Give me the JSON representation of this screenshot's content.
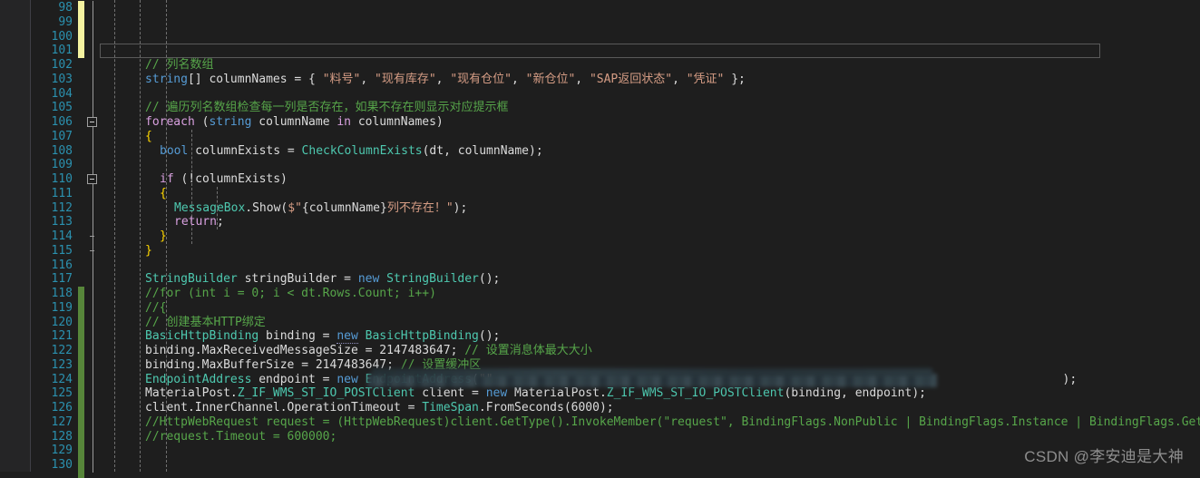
{
  "editor": {
    "theme": "visual-studio-dark",
    "background": "#1e1e1e",
    "gutter_background": "#252526",
    "line_number_color": "#2b91af",
    "comment_color": "#57a64a",
    "keyword_color": "#569cd6",
    "type_color": "#4ec9b0",
    "string_color": "#d69d85",
    "change_bar_unsaved_color": "#f5f3a0",
    "change_bar_saved_color": "#57863a",
    "first_line_number": 98,
    "last_line_number": 130
  },
  "line_numbers": [
    98,
    99,
    100,
    101,
    102,
    103,
    104,
    105,
    106,
    107,
    108,
    109,
    110,
    111,
    112,
    113,
    114,
    115,
    116,
    117,
    118,
    119,
    120,
    121,
    122,
    123,
    124,
    125,
    126,
    127,
    128,
    129,
    130
  ],
  "code_lines": [
    {
      "n": 98,
      "text": ""
    },
    {
      "n": 99,
      "text": ""
    },
    {
      "n": 100,
      "text": ""
    },
    {
      "n": 101,
      "text": ""
    },
    {
      "n": 102,
      "text": "            // 列名数组"
    },
    {
      "n": 103,
      "text": "            string[] columnNames = { \"料号\", \"现有库存\", \"现有仓位\", \"新仓位\", \"SAP返回状态\", \"凭证\" };"
    },
    {
      "n": 104,
      "text": ""
    },
    {
      "n": 105,
      "text": "            // 遍历列名数组检查每一列是否存在，如果不存在则显示对应提示框"
    },
    {
      "n": 106,
      "text": "            foreach (string columnName in columnNames)"
    },
    {
      "n": 107,
      "text": "            {"
    },
    {
      "n": 108,
      "text": "                bool columnExists = CheckColumnExists(dt, columnName);"
    },
    {
      "n": 109,
      "text": ""
    },
    {
      "n": 110,
      "text": "                if (!columnExists)"
    },
    {
      "n": 111,
      "text": "                {"
    },
    {
      "n": 112,
      "text": "                    MessageBox.Show($\"{columnName}列不存在！\");"
    },
    {
      "n": 113,
      "text": "                    return;"
    },
    {
      "n": 114,
      "text": "                }"
    },
    {
      "n": 115,
      "text": "            }"
    },
    {
      "n": 116,
      "text": ""
    },
    {
      "n": 117,
      "text": "            StringBuilder stringBuilder = new StringBuilder();"
    },
    {
      "n": 118,
      "text": "            //for (int i = 0; i < dt.Rows.Count; i++)"
    },
    {
      "n": 119,
      "text": "            //{"
    },
    {
      "n": 120,
      "text": "            // 创建基本HTTP绑定"
    },
    {
      "n": 121,
      "text": "            BasicHttpBinding binding = new BasicHttpBinding();"
    },
    {
      "n": 122,
      "text": "            binding.MaxReceivedMessageSize = 2147483647; // 设置消息体最大大小"
    },
    {
      "n": 123,
      "text": "            binding.MaxBufferSize = 2147483647; // 设置缓冲区"
    },
    {
      "n": 124,
      "text": "            EndpointAddress endpoint = new EndpointAddress(\"\");"
    },
    {
      "n": 125,
      "text": "            MaterialPost.Z_IF_WMS_ST_IO_POSTClient client = new MaterialPost.Z_IF_WMS_ST_IO_POSTClient(binding, endpoint);"
    },
    {
      "n": 126,
      "text": "            client.InnerChannel.OperationTimeout = TimeSpan.FromSeconds(6000);"
    },
    {
      "n": 127,
      "text": "            //HttpWebRequest request = (HttpWebRequest)client.GetType().InvokeMember(\"request\", BindingFlags.NonPublic | BindingFlags.Instance | BindingFlags.GetField, null, client, null);"
    },
    {
      "n": 128,
      "text": "            //request.Timeout = 600000;"
    },
    {
      "n": 129,
      "text": ""
    },
    {
      "n": 130,
      "text": ""
    }
  ],
  "tokens": {
    "l102": [
      {
        "t": "// 列名数组",
        "c": "cmt"
      }
    ],
    "l103": [
      {
        "t": "string",
        "c": "kw"
      },
      {
        "t": "[] ",
        "c": "pun"
      },
      {
        "t": "columnNames",
        "c": "id"
      },
      {
        "t": " = { ",
        "c": "pun"
      },
      {
        "t": "\"料号\"",
        "c": "str"
      },
      {
        "t": ", ",
        "c": "pun"
      },
      {
        "t": "\"现有库存\"",
        "c": "str"
      },
      {
        "t": ", ",
        "c": "pun"
      },
      {
        "t": "\"现有仓位\"",
        "c": "str"
      },
      {
        "t": ", ",
        "c": "pun"
      },
      {
        "t": "\"新仓位\"",
        "c": "str"
      },
      {
        "t": ", ",
        "c": "pun"
      },
      {
        "t": "\"SAP返回状态\"",
        "c": "str"
      },
      {
        "t": ", ",
        "c": "pun"
      },
      {
        "t": "\"凭证\"",
        "c": "str"
      },
      {
        "t": " };",
        "c": "pun"
      }
    ],
    "l105": [
      {
        "t": "// 遍历列名数组检查每一列是否存在，如果不存在则显示对应提示框",
        "c": "cmt"
      }
    ],
    "l106": [
      {
        "t": "foreach",
        "c": "kwc"
      },
      {
        "t": " (",
        "c": "pun"
      },
      {
        "t": "string",
        "c": "kw"
      },
      {
        "t": " columnName ",
        "c": "id"
      },
      {
        "t": "in",
        "c": "kwc"
      },
      {
        "t": " columnNames)",
        "c": "id"
      }
    ],
    "l108": [
      {
        "t": "bool",
        "c": "kw"
      },
      {
        "t": " columnExists = ",
        "c": "id"
      },
      {
        "t": "CheckColumnExists",
        "c": "typ"
      },
      {
        "t": "(dt, columnName);",
        "c": "id"
      }
    ],
    "l110": [
      {
        "t": "if",
        "c": "kwc"
      },
      {
        "t": " (!columnExists)",
        "c": "id"
      }
    ],
    "l112": [
      {
        "t": "MessageBox",
        "c": "typ"
      },
      {
        "t": ".",
        "c": "pun"
      },
      {
        "t": "Show",
        "c": "id"
      },
      {
        "t": "(",
        "c": "pun"
      },
      {
        "t": "$\"",
        "c": "str"
      },
      {
        "t": "{",
        "c": "pun"
      },
      {
        "t": "columnName",
        "c": "id"
      },
      {
        "t": "}",
        "c": "pun"
      },
      {
        "t": "列不存在！\"",
        "c": "str"
      },
      {
        "t": ");",
        "c": "pun"
      }
    ],
    "l113": [
      {
        "t": "return",
        "c": "kwc"
      },
      {
        "t": ";",
        "c": "pun"
      }
    ],
    "l117": [
      {
        "t": "StringBuilder",
        "c": "typ"
      },
      {
        "t": " stringBuilder = ",
        "c": "id"
      },
      {
        "t": "new",
        "c": "kw"
      },
      {
        "t": " ",
        "c": "pun"
      },
      {
        "t": "StringBuilder",
        "c": "typ"
      },
      {
        "t": "();",
        "c": "pun"
      }
    ],
    "l118": [
      {
        "t": "//for (int i = 0; i < dt.Rows.Count; i++)",
        "c": "cmt"
      }
    ],
    "l119": [
      {
        "t": "//{",
        "c": "cmt"
      }
    ],
    "l120": [
      {
        "t": "// 创建基本HTTP绑定",
        "c": "cmt"
      }
    ],
    "l121": [
      {
        "t": "BasicHttpBinding",
        "c": "typ"
      },
      {
        "t": " binding = ",
        "c": "id"
      },
      {
        "t": "new",
        "c": "kw"
      },
      {
        "t": " ",
        "c": "pun"
      },
      {
        "t": "BasicHttpBinding",
        "c": "typ"
      },
      {
        "t": "();",
        "c": "pun"
      }
    ],
    "l122": [
      {
        "t": "binding",
        "c": "id"
      },
      {
        "t": ".",
        "c": "pun"
      },
      {
        "t": "MaxReceivedMessageSize",
        "c": "id"
      },
      {
        "t": " = ",
        "c": "pun"
      },
      {
        "t": "2147483647",
        "c": "id"
      },
      {
        "t": "; ",
        "c": "pun"
      },
      {
        "t": "// 设置消息体最大大小",
        "c": "cmt"
      }
    ],
    "l123": [
      {
        "t": "binding",
        "c": "id"
      },
      {
        "t": ".",
        "c": "pun"
      },
      {
        "t": "MaxBufferSize",
        "c": "id"
      },
      {
        "t": " = ",
        "c": "pun"
      },
      {
        "t": "2147483647",
        "c": "id"
      },
      {
        "t": "; ",
        "c": "pun"
      },
      {
        "t": "// 设置缓冲区",
        "c": "cmt"
      }
    ],
    "l124_prefix": [
      {
        "t": "EndpointAddress",
        "c": "typ"
      },
      {
        "t": " endpoint = ",
        "c": "id"
      },
      {
        "t": "new",
        "c": "kw"
      },
      {
        "t": " ",
        "c": "pun"
      },
      {
        "t": "EndpointAddress",
        "c": "typ"
      },
      {
        "t": "(",
        "c": "pun"
      },
      {
        "t": "\"",
        "c": "str"
      }
    ],
    "l124_suffix": [
      {
        "t": "\"",
        "c": "str"
      },
      {
        "t": ");",
        "c": "pun"
      }
    ],
    "l125": [
      {
        "t": "MaterialPost",
        "c": "id"
      },
      {
        "t": ".",
        "c": "pun"
      },
      {
        "t": "Z_IF_WMS_ST_IO_POSTClient",
        "c": "typ"
      },
      {
        "t": " client = ",
        "c": "id"
      },
      {
        "t": "new",
        "c": "kw"
      },
      {
        "t": " ",
        "c": "pun"
      },
      {
        "t": "MaterialPost",
        "c": "id"
      },
      {
        "t": ".",
        "c": "pun"
      },
      {
        "t": "Z_IF_WMS_ST_IO_POSTClient",
        "c": "typ"
      },
      {
        "t": "(binding, endpoint);",
        "c": "id"
      }
    ],
    "l126": [
      {
        "t": "client",
        "c": "id"
      },
      {
        "t": ".",
        "c": "pun"
      },
      {
        "t": "InnerChannel",
        "c": "id"
      },
      {
        "t": ".",
        "c": "pun"
      },
      {
        "t": "OperationTimeout",
        "c": "id"
      },
      {
        "t": " = ",
        "c": "pun"
      },
      {
        "t": "TimeSpan",
        "c": "typ"
      },
      {
        "t": ".",
        "c": "pun"
      },
      {
        "t": "FromSeconds",
        "c": "id"
      },
      {
        "t": "(6000);",
        "c": "pun"
      }
    ],
    "l127": [
      {
        "t": "//HttpWebRequest request = (HttpWebRequest)client.GetType().InvokeMember(\"request\", BindingFlags.NonPublic | BindingFlags.Instance | BindingFlags.GetField, null, client, null);",
        "c": "cmt"
      }
    ],
    "l128": [
      {
        "t": "//request.Timeout = 600000;",
        "c": "cmt"
      }
    ]
  },
  "braces": {
    "l107": "{",
    "l111": "{",
    "l114": "}",
    "l115": "}"
  },
  "gutter": {
    "fold_markers": [
      {
        "line": 106,
        "state": "expanded",
        "glyph": "minus"
      },
      {
        "line": 110,
        "state": "expanded",
        "glyph": "minus"
      }
    ],
    "change_bars": [
      {
        "from_line": 98,
        "to_line": 101,
        "kind": "unsaved",
        "color": "#f5f3a0"
      },
      {
        "from_line": 118,
        "to_line": 130,
        "kind": "saved",
        "color": "#57863a"
      }
    ]
  },
  "current_line": {
    "line": 101,
    "border_color": "#5a5a5a"
  },
  "redactions": [
    {
      "name": "endpoint-url-blur",
      "line": 124,
      "label": "redacted endpoint address"
    }
  ],
  "watermark": {
    "text": "CSDN @李安迪是大神"
  }
}
